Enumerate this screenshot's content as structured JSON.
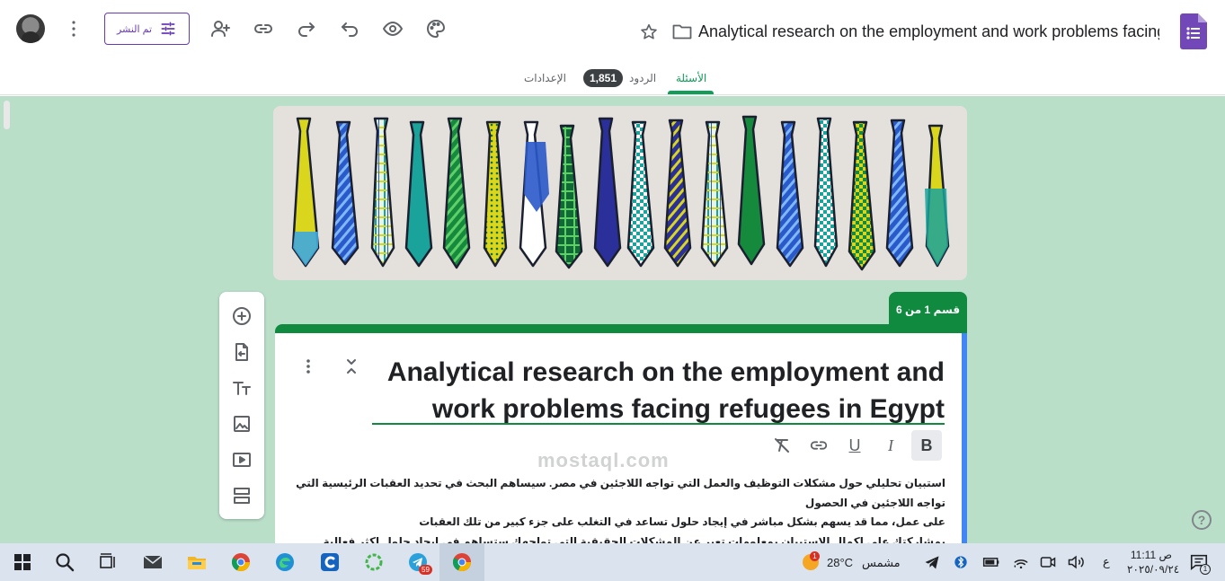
{
  "header": {
    "publish_label": "تم النشر",
    "form_title": "Analytical research on the employment and work problems facing refugees in Egypt"
  },
  "tabs": {
    "questions": "الأسئلة",
    "responses": "الردود",
    "responses_count": "1,851",
    "settings": "الإعدادات"
  },
  "section": {
    "tag": "قسم 1 من 6",
    "title": "Analytical research on the employment and work problems facing refugees in Egypt",
    "description_lines": [
      "استبيان تحليلي حول مشكلات التوظيف والعمل التي تواجه اللاجئين في مصر.  سيساهم البحث في تحديد العقبات الرئيسية التي تواجه اللاجئين في الحصول",
      "على عمل، مما قد يسهم بشكل مباشر في إيجاد حلول تساعد في التغلب على جزء كبير من تلك العقبات",
      "بمشاركتك علي اكمال الاستبيان بمعلومات تعبر عن المشكلات الحقيقية التي تواجهك ستساهم في ايجاد حلول اكثر فعالية."
    ]
  },
  "format_toolbar": [
    "B",
    "I",
    "U",
    "link",
    "clear-format"
  ],
  "taskbar": {
    "weather_temp": "28°C",
    "weather_text": "مشمس",
    "weather_badge": "1",
    "telegram_badge": "59",
    "lang": "ع",
    "time": "11:11 ص",
    "date": "٢٠٢٥/٠٩/٢٤",
    "notif_count": "1"
  },
  "watermark": "mostaql.com",
  "colors": {
    "accent": "#0f8a3e",
    "background": "#badfc9",
    "purple": "#673ab7",
    "blue_bar": "#4285f4"
  }
}
